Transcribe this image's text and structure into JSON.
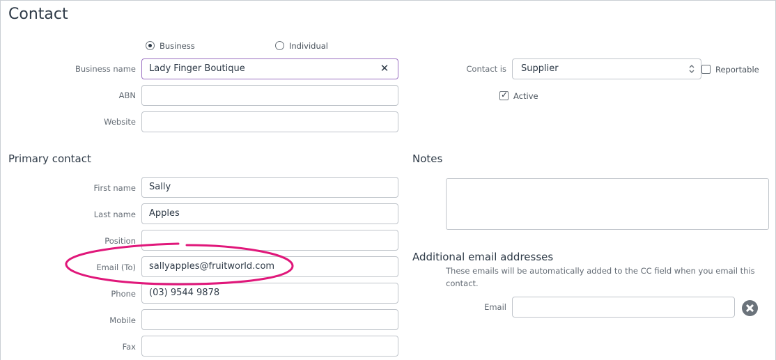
{
  "page": {
    "title": "Contact"
  },
  "contact_type": {
    "options": [
      {
        "label": "Business",
        "selected": true
      },
      {
        "label": "Individual",
        "selected": false
      }
    ]
  },
  "fields": {
    "business_name": {
      "label": "Business name",
      "value": "Lady Finger Boutique"
    },
    "abn": {
      "label": "ABN",
      "value": ""
    },
    "website": {
      "label": "Website",
      "value": ""
    }
  },
  "contact_is": {
    "label": "Contact is",
    "selected": "Supplier",
    "reportable_label": "Reportable",
    "reportable_checked": false,
    "active_label": "Active",
    "active_checked": true
  },
  "primary_contact": {
    "title": "Primary contact",
    "first_name": {
      "label": "First name",
      "value": "Sally"
    },
    "last_name": {
      "label": "Last name",
      "value": "Apples"
    },
    "position": {
      "label": "Position",
      "value": ""
    },
    "email": {
      "label": "Email (To)",
      "value": "sallyapples@fruitworld.com"
    },
    "phone": {
      "label": "Phone",
      "value": "(03) 9544 9878"
    },
    "mobile": {
      "label": "Mobile",
      "value": ""
    },
    "fax": {
      "label": "Fax",
      "value": ""
    }
  },
  "notes": {
    "title": "Notes",
    "value": ""
  },
  "additional_emails": {
    "title": "Additional email addresses",
    "helper": "These emails will be automatically added to the CC field when you email this contact.",
    "email_label": "Email",
    "email_value": ""
  },
  "icons": {
    "clear": "close-icon",
    "select_arrows": "chevron-up-down-icon",
    "remove": "remove-circle-icon"
  },
  "colors": {
    "focus_border": "#9a6fc1",
    "annotation": "#e0177a",
    "text": "#2e3a47"
  }
}
